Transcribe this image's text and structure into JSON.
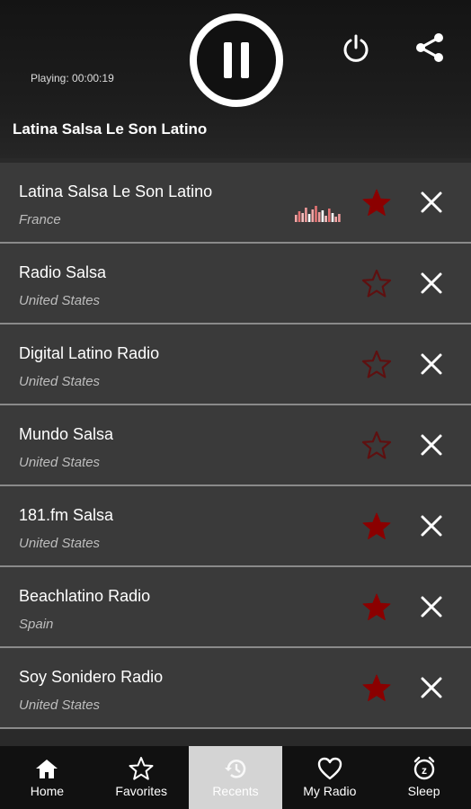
{
  "player": {
    "playing_label": "Playing: 00:00:19",
    "current_station": "Latina Salsa Le Son Latino",
    "state": "playing"
  },
  "stations": [
    {
      "name": "Latina Salsa Le Son Latino",
      "country": "France",
      "favorite": true,
      "now_playing": true
    },
    {
      "name": "Radio Salsa",
      "country": "United States",
      "favorite": false,
      "now_playing": false
    },
    {
      "name": "Digital Latino Radio",
      "country": "United States",
      "favorite": false,
      "now_playing": false
    },
    {
      "name": "Mundo Salsa",
      "country": "United States",
      "favorite": false,
      "now_playing": false
    },
    {
      "name": "181.fm Salsa",
      "country": "United States",
      "favorite": true,
      "now_playing": false
    },
    {
      "name": "Beachlatino Radio",
      "country": "Spain",
      "favorite": true,
      "now_playing": false
    },
    {
      "name": "Soy Sonidero Radio",
      "country": "United States",
      "favorite": true,
      "now_playing": false
    }
  ],
  "nav": [
    {
      "label": "Home",
      "icon": "home-icon",
      "active": false
    },
    {
      "label": "Favorites",
      "icon": "star-icon",
      "active": false
    },
    {
      "label": "Recents",
      "icon": "history-icon",
      "active": true
    },
    {
      "label": "My Radio",
      "icon": "heart-icon",
      "active": false
    },
    {
      "label": "Sleep",
      "icon": "alarm-icon",
      "active": false
    }
  ],
  "colors": {
    "favorite_star": "#8b0000",
    "row_bg": "#3a3a3a",
    "nav_bg": "#111111",
    "nav_active_bg": "#d4d4d4"
  }
}
